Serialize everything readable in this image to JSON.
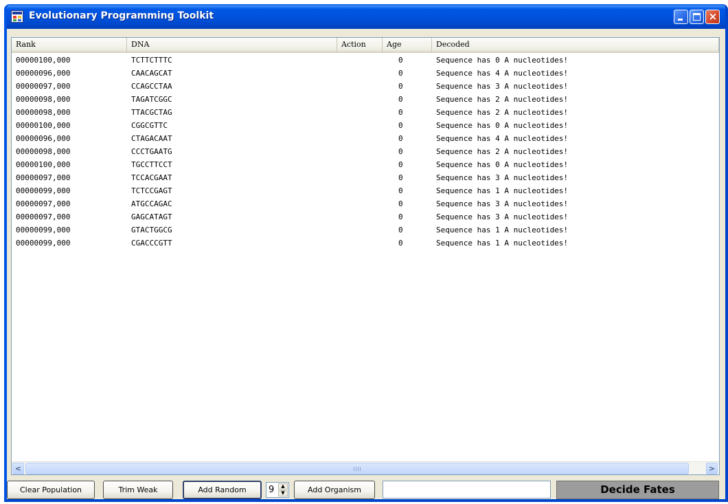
{
  "window": {
    "title": "Evolutionary Programming Toolkit",
    "close_glyph": "×"
  },
  "list": {
    "columns": [
      "Rank",
      "DNA",
      "Action",
      "Age",
      "Decoded"
    ],
    "rows": [
      {
        "rank": "00000100,000",
        "dna": "TCTTCTTTC",
        "action": "",
        "age": "0",
        "decoded": "Sequence has 0 A nucleotides!"
      },
      {
        "rank": "00000096,000",
        "dna": "CAACAGCAT",
        "action": "",
        "age": "0",
        "decoded": "Sequence has 4 A nucleotides!"
      },
      {
        "rank": "00000097,000",
        "dna": "CCAGCCTAA",
        "action": "",
        "age": "0",
        "decoded": "Sequence has 3 A nucleotides!"
      },
      {
        "rank": "00000098,000",
        "dna": "TAGATCGGC",
        "action": "",
        "age": "0",
        "decoded": "Sequence has 2 A nucleotides!"
      },
      {
        "rank": "00000098,000",
        "dna": "TTACGCTAG",
        "action": "",
        "age": "0",
        "decoded": "Sequence has 2 A nucleotides!"
      },
      {
        "rank": "00000100,000",
        "dna": "CGGCGTTC",
        "action": "",
        "age": "0",
        "decoded": "Sequence has 0 A nucleotides!"
      },
      {
        "rank": "00000096,000",
        "dna": "CTAGACAAT",
        "action": "",
        "age": "0",
        "decoded": "Sequence has 4 A nucleotides!"
      },
      {
        "rank": "00000098,000",
        "dna": "CCCTGAATG",
        "action": "",
        "age": "0",
        "decoded": "Sequence has 2 A nucleotides!"
      },
      {
        "rank": "00000100,000",
        "dna": "TGCCTTCCT",
        "action": "",
        "age": "0",
        "decoded": "Sequence has 0 A nucleotides!"
      },
      {
        "rank": "00000097,000",
        "dna": "TCCACGAAT",
        "action": "",
        "age": "0",
        "decoded": "Sequence has 3 A nucleotides!"
      },
      {
        "rank": "00000099,000",
        "dna": "TCTCCGAGT",
        "action": "",
        "age": "0",
        "decoded": "Sequence has 1 A nucleotides!"
      },
      {
        "rank": "00000097,000",
        "dna": "ATGCCAGAC",
        "action": "",
        "age": "0",
        "decoded": "Sequence has 3 A nucleotides!"
      },
      {
        "rank": "00000097,000",
        "dna": "GAGCATAGT",
        "action": "",
        "age": "0",
        "decoded": "Sequence has 3 A nucleotides!"
      },
      {
        "rank": "00000099,000",
        "dna": "GTACTGGCG",
        "action": "",
        "age": "0",
        "decoded": "Sequence has 1 A nucleotides!"
      },
      {
        "rank": "00000099,000",
        "dna": "CGACCCGTT",
        "action": "",
        "age": "0",
        "decoded": "Sequence has 1 A nucleotides!"
      }
    ]
  },
  "toolbar": {
    "clear_label": "Clear Population",
    "trim_label": "Trim Weak",
    "add_random_label": "Add Random",
    "random_count": "9",
    "add_organism_label": "Add Organism",
    "organism_value": "",
    "decide_label": "Decide Fates"
  },
  "scrollbar": {
    "left_arrow": "<",
    "right_arrow": ">"
  },
  "colors": {
    "titlebar": "#0054e3",
    "decide_bg": "#9c9c9c"
  }
}
